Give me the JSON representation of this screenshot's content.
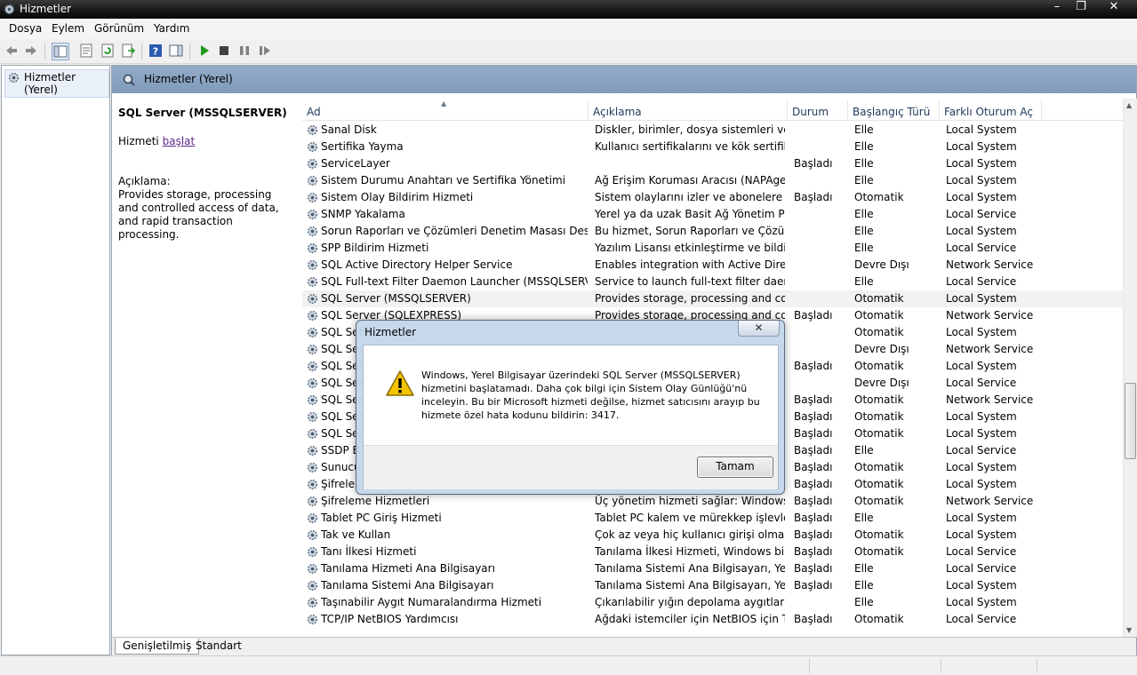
{
  "window": {
    "title": "Hizmetler"
  },
  "menu": {
    "items": [
      "Dosya",
      "Eylem",
      "Görünüm",
      "Yardım"
    ]
  },
  "left": {
    "node_label": "Hizmetler (Yerel)"
  },
  "main": {
    "header_title": "Hizmetler (Yerel)"
  },
  "details": {
    "service_name": "SQL Server (MSSQLSERVER)",
    "action_prefix": "Hizmeti",
    "action_link": "başlat",
    "desc_label": "Açıklama:",
    "desc_text": "Provides storage, processing and controlled access of data, and rapid transaction processing."
  },
  "list": {
    "columns": [
      "Ad",
      "Açıklama",
      "Durum",
      "Başlangıç Türü",
      "Farklı Oturum Aç"
    ],
    "rows": [
      {
        "name": "Sanal Disk",
        "desc": "Diskler, birimler, dosya sistemleri ve de...",
        "status": "",
        "startup": "Elle",
        "logon": "Local System"
      },
      {
        "name": "Sertifika Yayma",
        "desc": "Kullanıcı sertifikalarını ve kök sertifikal...",
        "status": "",
        "startup": "Elle",
        "logon": "Local System"
      },
      {
        "name": "ServiceLayer",
        "desc": "",
        "status": "Başladı",
        "startup": "Elle",
        "logon": "Local System"
      },
      {
        "name": "Sistem Durumu Anahtarı ve Sertifika Yönetimi",
        "desc": "Ağ Erişim Koruması Aracısı (NAPAgen...",
        "status": "",
        "startup": "Elle",
        "logon": "Local System"
      },
      {
        "name": "Sistem Olay Bildirim Hizmeti",
        "desc": "Sistem olaylarını izler ve abonelere bu ...",
        "status": "Başladı",
        "startup": "Otomatik",
        "logon": "Local System"
      },
      {
        "name": "SNMP Yakalama",
        "desc": "Yerel ya da uzak Basit Ağ Yönetim Prot...",
        "status": "",
        "startup": "Elle",
        "logon": "Local Service"
      },
      {
        "name": "Sorun Raporları ve Çözümleri Denetim Masası Desteği",
        "desc": "Bu hizmet, Sorun Raporları ve Çözüml...",
        "status": "",
        "startup": "Elle",
        "logon": "Local System"
      },
      {
        "name": "SPP Bildirim Hizmeti",
        "desc": "Yazılım Lisansı etkinleştirme ve bildiri...",
        "status": "",
        "startup": "Elle",
        "logon": "Local Service"
      },
      {
        "name": "SQL Active Directory Helper Service",
        "desc": "Enables integration with Active Direct...",
        "status": "",
        "startup": "Devre Dışı",
        "logon": "Network Service"
      },
      {
        "name": "SQL Full-text Filter Daemon Launcher (MSSQLSERVER)",
        "desc": "Service to launch full-text filter daemo...",
        "status": "",
        "startup": "Elle",
        "logon": "Local Service"
      },
      {
        "name": "SQL Server (MSSQLSERVER)",
        "desc": "Provides storage, processing and cont...",
        "status": "",
        "startup": "Otomatik",
        "logon": "Local System"
      },
      {
        "name": "SQL Server (SQLEXPRESS)",
        "desc": "Provides storage, processing and cont...",
        "status": "Başladı",
        "startup": "Otomatik",
        "logon": "Network Service"
      },
      {
        "name": "SQL Ser",
        "desc": "",
        "status": "",
        "startup": "Otomatik",
        "logon": "Local System"
      },
      {
        "name": "SQL Ser",
        "desc": "",
        "status": "",
        "startup": "Devre Dışı",
        "logon": "Network Service"
      },
      {
        "name": "SQL Ser",
        "desc": "",
        "status": "Başladı",
        "startup": "Otomatik",
        "logon": "Local System"
      },
      {
        "name": "SQL Ser",
        "desc": "",
        "status": "",
        "startup": "Devre Dışı",
        "logon": "Local Service"
      },
      {
        "name": "SQL Ser",
        "desc": "",
        "status": "Başladı",
        "startup": "Otomatik",
        "logon": "Network Service"
      },
      {
        "name": "SQL Ser",
        "desc": "",
        "status": "Başladı",
        "startup": "Otomatik",
        "logon": "Local System"
      },
      {
        "name": "SQL Ser",
        "desc": "",
        "status": "Başladı",
        "startup": "Otomatik",
        "logon": "Local System"
      },
      {
        "name": "SSDP B",
        "desc": "",
        "status": "Başladı",
        "startup": "Elle",
        "logon": "Local Service"
      },
      {
        "name": "Sunucu",
        "desc": "",
        "status": "Başladı",
        "startup": "Otomatik",
        "logon": "Local System"
      },
      {
        "name": "Şifrele",
        "desc": "",
        "status": "Başladı",
        "startup": "Otomatik",
        "logon": "Local System"
      },
      {
        "name": "Şifreleme Hizmetleri",
        "desc": "Üç yönetim hizmeti sağlar: Windows d...",
        "status": "Başladı",
        "startup": "Otomatik",
        "logon": "Network Service"
      },
      {
        "name": "Tablet PC Giriş Hizmeti",
        "desc": "Tablet PC kalem ve mürekkep işlevleri...",
        "status": "Başladı",
        "startup": "Elle",
        "logon": "Local System"
      },
      {
        "name": "Tak ve Kullan",
        "desc": "Çok az veya hiç kullanıcı girişi olmada...",
        "status": "Başladı",
        "startup": "Otomatik",
        "logon": "Local System"
      },
      {
        "name": "Tanı İlkesi Hizmeti",
        "desc": "Tanılama İlkesi Hizmeti, Windows bile...",
        "status": "Başladı",
        "startup": "Otomatik",
        "logon": "Local Service"
      },
      {
        "name": "Tanılama Hizmeti Ana Bilgisayarı",
        "desc": "Tanılama Sistemi Ana Bilgisayarı, Yerel...",
        "status": "Başladı",
        "startup": "Elle",
        "logon": "Local Service"
      },
      {
        "name": "Tanılama Sistemi Ana Bilgisayarı",
        "desc": "Tanılama Sistemi Ana Bilgisayarı, Yerel...",
        "status": "Başladı",
        "startup": "Elle",
        "logon": "Local System"
      },
      {
        "name": "Taşınabilir Aygıt Numaralandırma Hizmeti",
        "desc": "Çıkarılabilir yığın depolama aygıtları i...",
        "status": "",
        "startup": "Elle",
        "logon": "Local System"
      },
      {
        "name": "TCP/IP NetBIOS Yardımcısı",
        "desc": "Ağdaki istemciler için NetBIOS için TC...",
        "status": "Başladı",
        "startup": "Otomatik",
        "logon": "Local Service"
      }
    ]
  },
  "tabs": [
    "Genişletilmiş",
    "Standart"
  ],
  "dialog": {
    "title": "Hizmetler",
    "message": "Windows, Yerel Bilgisayar üzerindeki SQL Server (MSSQLSERVER) hizmetini başlatamadı. Daha çok bilgi için Sistem Olay Günlüğü'nü inceleyin. Bu bir Microsoft hizmeti değilse, hizmet satıcısını arayıp bu hizmete özel hata kodunu bildirin: 3417.",
    "ok_label": "Tamam"
  },
  "colors": {
    "header_blue": "#8aa3c3",
    "link_purple": "#5e2c8c"
  }
}
